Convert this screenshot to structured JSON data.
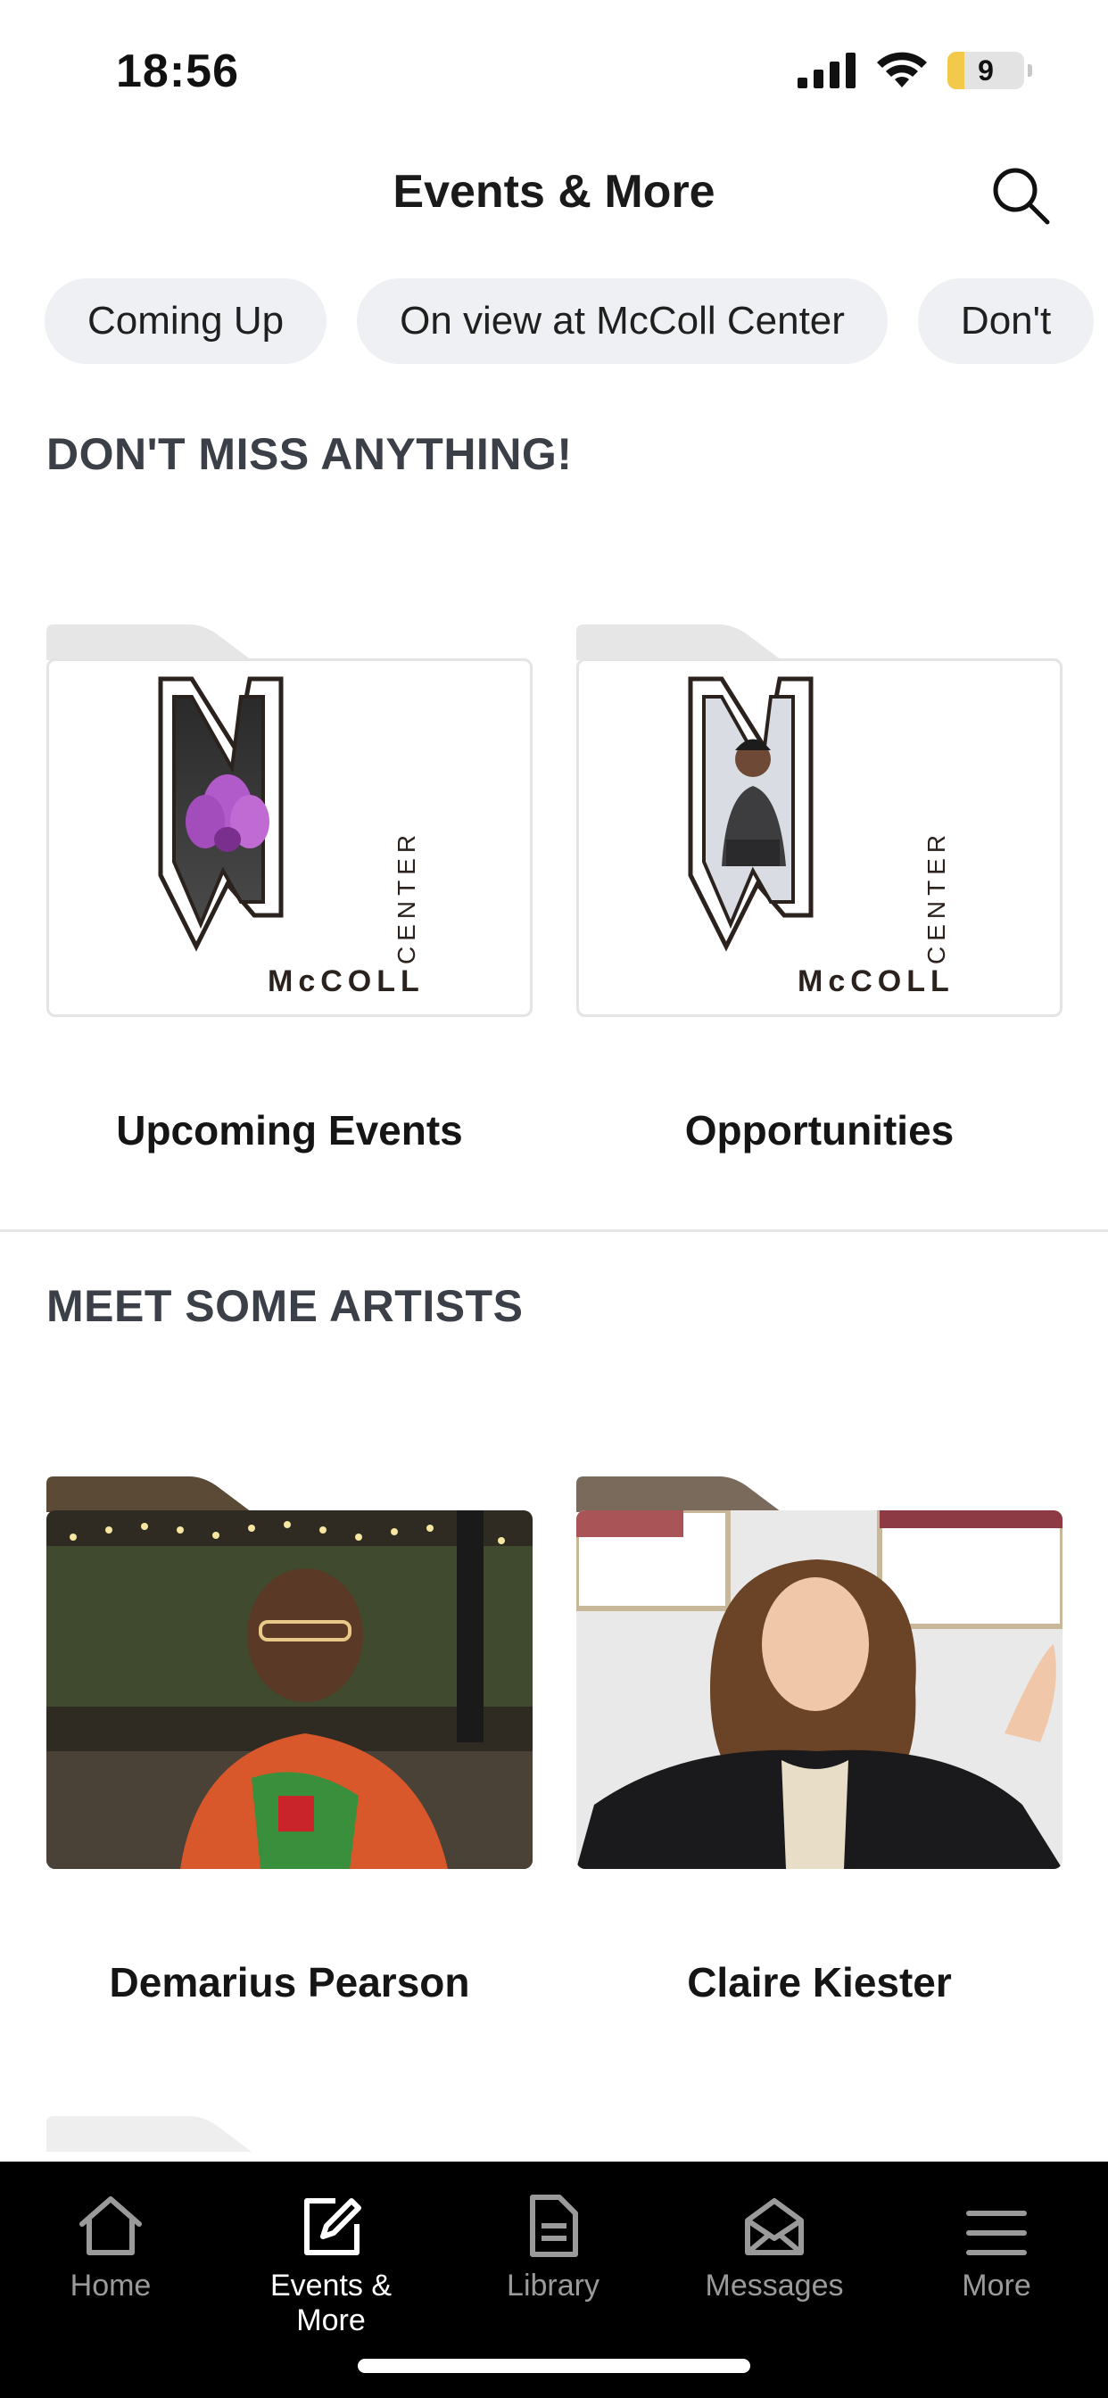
{
  "status": {
    "time": "18:56",
    "battery": "9"
  },
  "header": {
    "title": "Events & More"
  },
  "chips": [
    "Coming Up",
    "On view at McColl Center",
    "Don't"
  ],
  "sections": {
    "dont_miss": {
      "title": "DON'T MISS ANYTHING!",
      "cards": [
        {
          "label": "Upcoming Events",
          "logo_name": "McCOLL",
          "logo_sub": "CENTER"
        },
        {
          "label": "Opportunities",
          "logo_name": "McCOLL",
          "logo_sub": "CENTER"
        }
      ]
    },
    "artists": {
      "title": "MEET SOME ARTISTS",
      "cards": [
        {
          "label": "Demarius Pearson"
        },
        {
          "label": "Claire Kiester"
        }
      ]
    }
  },
  "tabbar": {
    "items": [
      {
        "label": "Home",
        "icon": "home-icon"
      },
      {
        "label": "Events & More",
        "icon": "edit-square-icon",
        "active": true
      },
      {
        "label": "Library",
        "icon": "document-icon"
      },
      {
        "label": "Messages",
        "icon": "envelope-open-icon"
      },
      {
        "label": "More",
        "icon": "menu-icon"
      }
    ]
  },
  "colors": {
    "accent_bg": "#eef0f3",
    "heading": "#3b3f47",
    "tabbar": "#000000"
  }
}
